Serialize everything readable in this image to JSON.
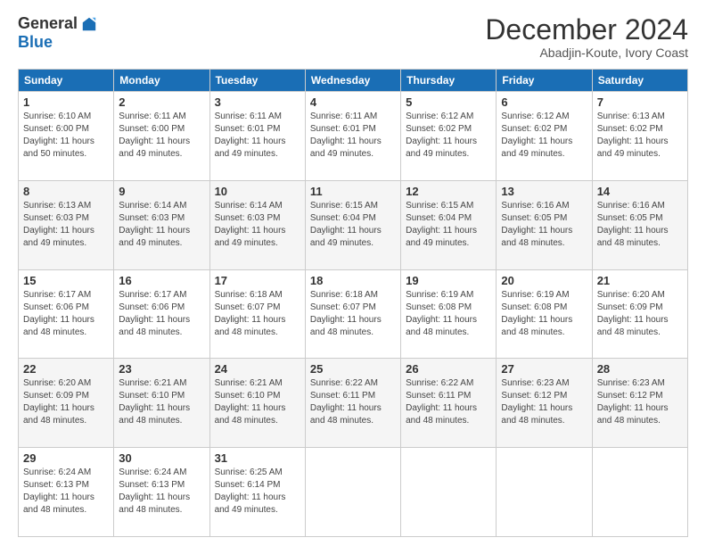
{
  "logo": {
    "general": "General",
    "blue": "Blue"
  },
  "header": {
    "month": "December 2024",
    "location": "Abadjin-Koute, Ivory Coast"
  },
  "weekdays": [
    "Sunday",
    "Monday",
    "Tuesday",
    "Wednesday",
    "Thursday",
    "Friday",
    "Saturday"
  ],
  "weeks": [
    [
      {
        "day": "1",
        "sunrise": "6:10 AM",
        "sunset": "6:00 PM",
        "daylight": "11 hours and 50 minutes."
      },
      {
        "day": "2",
        "sunrise": "6:11 AM",
        "sunset": "6:00 PM",
        "daylight": "11 hours and 49 minutes."
      },
      {
        "day": "3",
        "sunrise": "6:11 AM",
        "sunset": "6:01 PM",
        "daylight": "11 hours and 49 minutes."
      },
      {
        "day": "4",
        "sunrise": "6:11 AM",
        "sunset": "6:01 PM",
        "daylight": "11 hours and 49 minutes."
      },
      {
        "day": "5",
        "sunrise": "6:12 AM",
        "sunset": "6:02 PM",
        "daylight": "11 hours and 49 minutes."
      },
      {
        "day": "6",
        "sunrise": "6:12 AM",
        "sunset": "6:02 PM",
        "daylight": "11 hours and 49 minutes."
      },
      {
        "day": "7",
        "sunrise": "6:13 AM",
        "sunset": "6:02 PM",
        "daylight": "11 hours and 49 minutes."
      }
    ],
    [
      {
        "day": "8",
        "sunrise": "6:13 AM",
        "sunset": "6:03 PM",
        "daylight": "11 hours and 49 minutes."
      },
      {
        "day": "9",
        "sunrise": "6:14 AM",
        "sunset": "6:03 PM",
        "daylight": "11 hours and 49 minutes."
      },
      {
        "day": "10",
        "sunrise": "6:14 AM",
        "sunset": "6:03 PM",
        "daylight": "11 hours and 49 minutes."
      },
      {
        "day": "11",
        "sunrise": "6:15 AM",
        "sunset": "6:04 PM",
        "daylight": "11 hours and 49 minutes."
      },
      {
        "day": "12",
        "sunrise": "6:15 AM",
        "sunset": "6:04 PM",
        "daylight": "11 hours and 49 minutes."
      },
      {
        "day": "13",
        "sunrise": "6:16 AM",
        "sunset": "6:05 PM",
        "daylight": "11 hours and 48 minutes."
      },
      {
        "day": "14",
        "sunrise": "6:16 AM",
        "sunset": "6:05 PM",
        "daylight": "11 hours and 48 minutes."
      }
    ],
    [
      {
        "day": "15",
        "sunrise": "6:17 AM",
        "sunset": "6:06 PM",
        "daylight": "11 hours and 48 minutes."
      },
      {
        "day": "16",
        "sunrise": "6:17 AM",
        "sunset": "6:06 PM",
        "daylight": "11 hours and 48 minutes."
      },
      {
        "day": "17",
        "sunrise": "6:18 AM",
        "sunset": "6:07 PM",
        "daylight": "11 hours and 48 minutes."
      },
      {
        "day": "18",
        "sunrise": "6:18 AM",
        "sunset": "6:07 PM",
        "daylight": "11 hours and 48 minutes."
      },
      {
        "day": "19",
        "sunrise": "6:19 AM",
        "sunset": "6:08 PM",
        "daylight": "11 hours and 48 minutes."
      },
      {
        "day": "20",
        "sunrise": "6:19 AM",
        "sunset": "6:08 PM",
        "daylight": "11 hours and 48 minutes."
      },
      {
        "day": "21",
        "sunrise": "6:20 AM",
        "sunset": "6:09 PM",
        "daylight": "11 hours and 48 minutes."
      }
    ],
    [
      {
        "day": "22",
        "sunrise": "6:20 AM",
        "sunset": "6:09 PM",
        "daylight": "11 hours and 48 minutes."
      },
      {
        "day": "23",
        "sunrise": "6:21 AM",
        "sunset": "6:10 PM",
        "daylight": "11 hours and 48 minutes."
      },
      {
        "day": "24",
        "sunrise": "6:21 AM",
        "sunset": "6:10 PM",
        "daylight": "11 hours and 48 minutes."
      },
      {
        "day": "25",
        "sunrise": "6:22 AM",
        "sunset": "6:11 PM",
        "daylight": "11 hours and 48 minutes."
      },
      {
        "day": "26",
        "sunrise": "6:22 AM",
        "sunset": "6:11 PM",
        "daylight": "11 hours and 48 minutes."
      },
      {
        "day": "27",
        "sunrise": "6:23 AM",
        "sunset": "6:12 PM",
        "daylight": "11 hours and 48 minutes."
      },
      {
        "day": "28",
        "sunrise": "6:23 AM",
        "sunset": "6:12 PM",
        "daylight": "11 hours and 48 minutes."
      }
    ],
    [
      {
        "day": "29",
        "sunrise": "6:24 AM",
        "sunset": "6:13 PM",
        "daylight": "11 hours and 48 minutes."
      },
      {
        "day": "30",
        "sunrise": "6:24 AM",
        "sunset": "6:13 PM",
        "daylight": "11 hours and 48 minutes."
      },
      {
        "day": "31",
        "sunrise": "6:25 AM",
        "sunset": "6:14 PM",
        "daylight": "11 hours and 49 minutes."
      },
      null,
      null,
      null,
      null
    ]
  ]
}
